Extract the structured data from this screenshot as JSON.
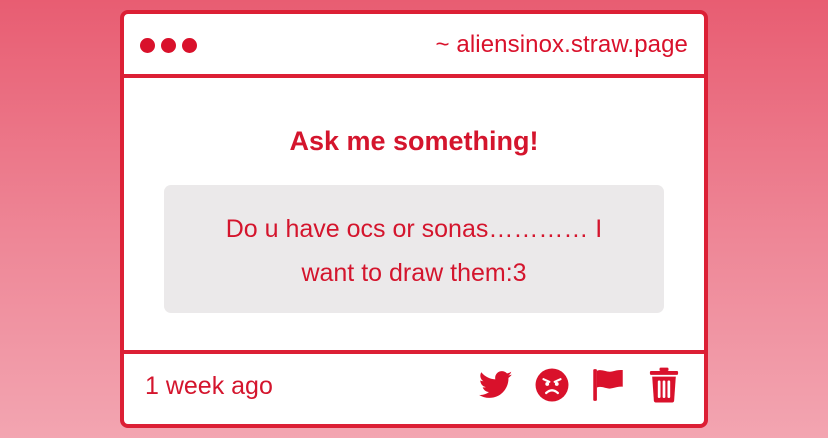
{
  "colors": {
    "accent": "#d9112b",
    "border": "#dc1f35",
    "question_background": "#ebe9ea",
    "background_top": "#e85d72",
    "background_bottom": "#f3a5b1"
  },
  "window": {
    "title_url": "~ aliensinox.straw.page",
    "controls": [
      "dot-icon",
      "dot-icon",
      "dot-icon"
    ]
  },
  "content": {
    "heading": "Ask me something!",
    "question": "Do u have ocs or sonas………… I want to draw them:3"
  },
  "footer": {
    "timestamp": "1 week ago",
    "actions": [
      "twitter-icon",
      "angry-face-icon",
      "flag-icon",
      "trash-icon"
    ]
  }
}
